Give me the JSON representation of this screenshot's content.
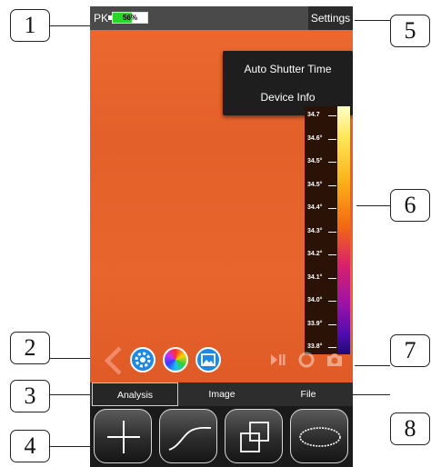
{
  "callouts": [
    "1",
    "2",
    "3",
    "4",
    "5",
    "6",
    "7",
    "8"
  ],
  "status_bar": {
    "pk_label": "PK",
    "battery_percent": 56,
    "battery_label": "56%",
    "settings_label": "Settings"
  },
  "settings_menu": {
    "items": [
      "Auto Shutter Time",
      "Device Info"
    ]
  },
  "temperature_scale": {
    "ticks": [
      "34.7",
      "34.6°",
      "34.5°",
      "34.5°",
      "34.4°",
      "34.3°",
      "34.2°",
      "34.1°",
      "34.0°",
      "33.9°",
      "33.8°"
    ],
    "colors": [
      "#ffffc8",
      "#fbb21c",
      "#d9216c",
      "#1d0a70"
    ]
  },
  "tool_row": {
    "icons": [
      "back-chevron-icon",
      "settings-gear-icon",
      "palette-icon",
      "image-icon",
      "play-pause-icon",
      "record-icon",
      "camera-icon"
    ]
  },
  "tabs": [
    {
      "label": "Analysis",
      "active": true
    },
    {
      "label": "Image",
      "active": false
    },
    {
      "label": "File",
      "active": false
    }
  ],
  "analysis_tools": [
    "crosshair-point-icon",
    "line-icon",
    "area-box-icon",
    "ellipse-icon"
  ],
  "colors": {
    "thermal_background": "#e9632e",
    "status_bar": "#4a4a4a",
    "battery_fill": "#2ad62a",
    "settings_blue": "#1e88e5"
  }
}
